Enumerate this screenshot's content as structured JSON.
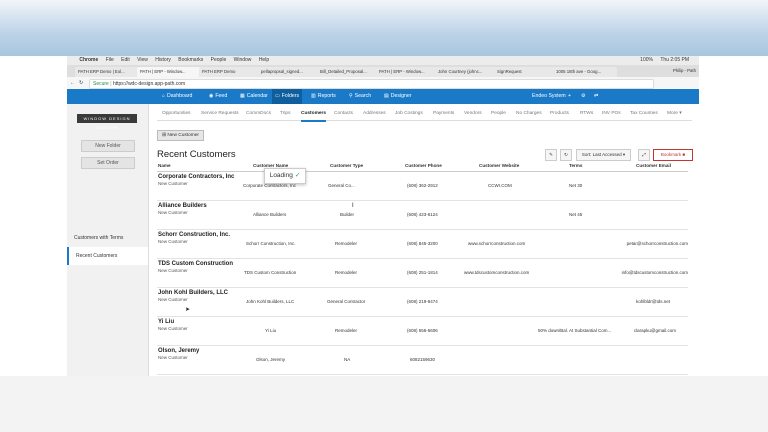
{
  "mac_menu": {
    "apple": "",
    "app": "Chrome",
    "items": [
      "File",
      "Edit",
      "View",
      "History",
      "Bookmarks",
      "People",
      "Window",
      "Help"
    ],
    "status": "100%",
    "clock": "Thu 2:05 PM"
  },
  "browser": {
    "tabs": [
      "PATH ERP Demo | Eol...",
      "PATH | ERP - Window...",
      "PATH ERP Demo",
      "pellapropsal_signed...",
      "Bill_Detailed_Proposal...",
      "PATH | ERP - Window...",
      "John Courtney (johnc...",
      "SignRequest",
      "1005 18th ave - Goog..."
    ],
    "profile": "Philip - Path",
    "secure_label": "Secure",
    "url": "https://wdc-design.app-path.com"
  },
  "nav": {
    "items": [
      {
        "label": "Dashboard",
        "icon": "⌂"
      },
      {
        "label": "Feed",
        "icon": "◉"
      },
      {
        "label": "Calendar",
        "icon": "▦"
      },
      {
        "label": "Folders",
        "icon": "▭"
      },
      {
        "label": "Reports",
        "icon": "▥"
      },
      {
        "label": "Search",
        "icon": "⚲"
      },
      {
        "label": "Designer",
        "icon": "▤"
      }
    ],
    "user": "Endeo System",
    "icons": [
      "+",
      "⚙",
      "⇄"
    ]
  },
  "sidebar": {
    "logo": "WINDOW DESIGN CENTER",
    "new_folder": "New Folder",
    "set_order": "Set Order",
    "links": [
      "Customers with Terms",
      "Recent Customers"
    ]
  },
  "subnav": [
    "Opportunities",
    "Service Requests",
    "CommDocs",
    "Trips",
    "Customers",
    "Contacts",
    "Addresses",
    "Job Costings",
    "Payments",
    "Vendors",
    "People",
    "No Charges",
    "Products",
    "RTWs",
    "INV POs",
    "Tax Counties",
    "More ▾"
  ],
  "toolbar": {
    "new_customer": "New Customer",
    "title": "Recent Customers",
    "sort": "Sort: Last Accessed",
    "bookmark": "Bookmark"
  },
  "table": {
    "headers": [
      "Name",
      "Customer Name",
      "Customer Type",
      "Customer Phone",
      "Customer Website",
      "Terms",
      "Customer Email"
    ],
    "rows": [
      {
        "name": "Corporate Contractors, Inc",
        "status": "New Customer",
        "cname": "Corporate Contractors, Inc",
        "type": "General Co...",
        "phone": "(608) 362-2912",
        "website": "CCWI.COM",
        "terms": "Net 30",
        "email": ""
      },
      {
        "name": "Alliance Builders",
        "status": "New Customer",
        "cname": "Alliance Builders",
        "type": "Builder",
        "phone": "(608) 423-6124",
        "website": "",
        "terms": "Net 45",
        "email": ""
      },
      {
        "name": "Schorr Construction, Inc.",
        "status": "New Customer",
        "cname": "Schorr Construction, Inc.",
        "type": "Remodeler",
        "phone": "(608) 845-3200",
        "website": "www.schorrconstruction.com",
        "terms": "",
        "email": "petar@schorrconstruction.com"
      },
      {
        "name": "TDS Custom Construction",
        "status": "New Customer",
        "cname": "TDS Custom Construction",
        "type": "Remodeler",
        "phone": "(608) 251-1814",
        "website": "www.tdscustomconstruction.com",
        "terms": "",
        "email": "info@tdscustomconstruction.com"
      },
      {
        "name": "John Kohl Builders, LLC",
        "status": "New Customer",
        "cname": "John Kohl Builders, LLC",
        "type": "General Contractor",
        "phone": "(608) 219-9474",
        "website": "",
        "terms": "",
        "email": "kohlbldr@tds.net"
      },
      {
        "name": "Yi Liu",
        "status": "New Customer",
        "cname": "Yi Liu",
        "type": "Remodeler",
        "phone": "(608) 556-5606",
        "website": "",
        "terms": "50% down/Bal. At Substantial Com...",
        "email": "clarapku@gmail.com"
      },
      {
        "name": "Olson, Jeremy",
        "status": "New Customer",
        "cname": "Olson, Jeremy",
        "type": "NA",
        "phone": "6082159630",
        "website": "",
        "terms": "",
        "email": ""
      }
    ]
  },
  "loading_label": "Loading"
}
